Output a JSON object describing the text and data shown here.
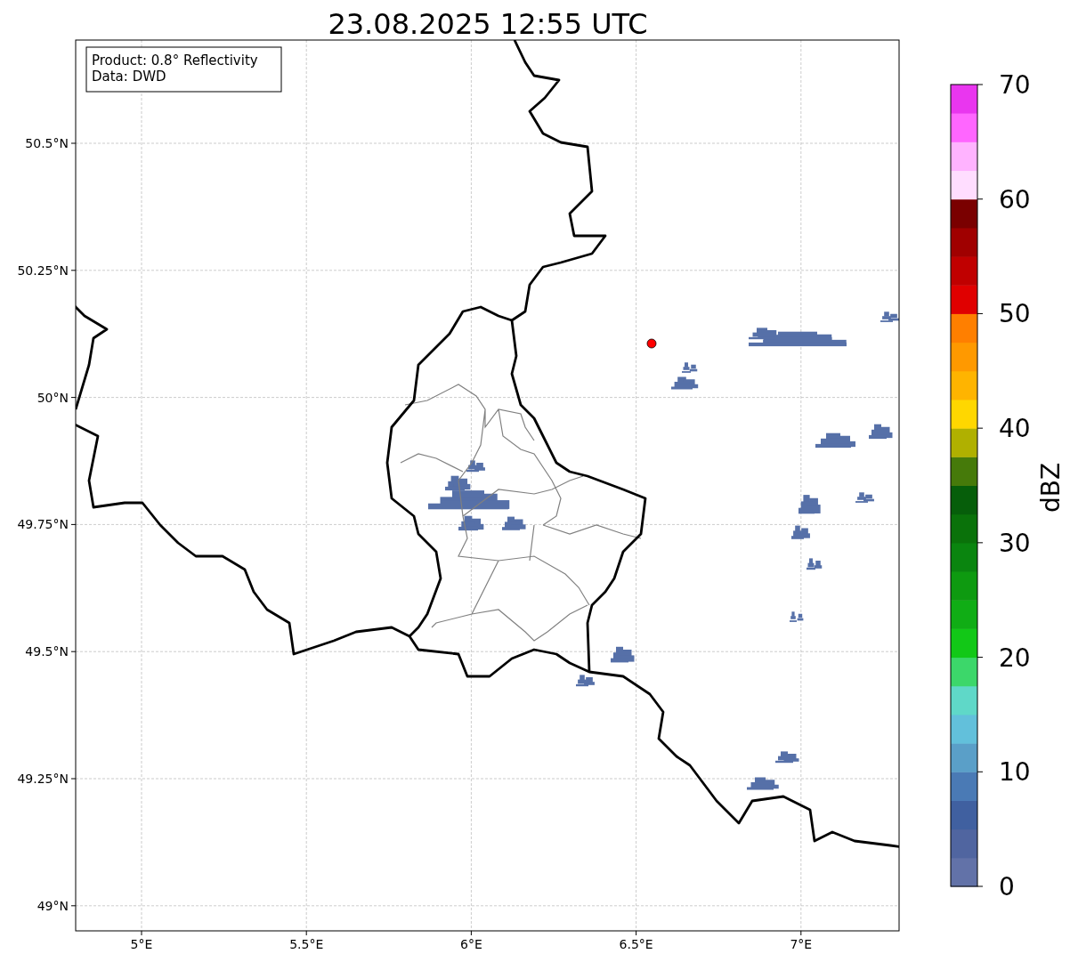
{
  "title": "23.08.2025 12:55 UTC",
  "map": {
    "info_box": [
      "Product: 0.8° Reflectivity",
      "Data: DWD"
    ],
    "yticks": [
      "50.5°N",
      "50.25°N",
      "50°N",
      "49.75°N",
      "49.5°N",
      "49.25°N",
      "49°N"
    ],
    "xticks": [
      "5°E",
      "5.5°E",
      "6°E",
      "6.5°E",
      "7°E"
    ]
  },
  "colorbar": {
    "label": "dBZ",
    "ticks": [
      "70",
      "60",
      "50",
      "40",
      "30",
      "20",
      "10",
      "0"
    ],
    "bins": [
      {
        "color": "#6272a8"
      },
      {
        "color": "#5065a0"
      },
      {
        "color": "#4060a0"
      },
      {
        "color": "#4a7ab5"
      },
      {
        "color": "#5a9fc8"
      },
      {
        "color": "#62c0db"
      },
      {
        "color": "#5fd8c8"
      },
      {
        "color": "#3cd76a"
      },
      {
        "color": "#12c817"
      },
      {
        "color": "#10ad15"
      },
      {
        "color": "#0e9a10"
      },
      {
        "color": "#0a850f"
      },
      {
        "color": "#0a720a"
      },
      {
        "color": "#065e0a"
      },
      {
        "color": "#467a0a"
      },
      {
        "color": "#b0b000"
      },
      {
        "color": "#ffd700"
      },
      {
        "color": "#ffb400"
      },
      {
        "color": "#ff9900"
      },
      {
        "color": "#ff7f00"
      },
      {
        "color": "#e00000"
      },
      {
        "color": "#c00000"
      },
      {
        "color": "#a00000"
      },
      {
        "color": "#7a0000"
      },
      {
        "color": "#ffddff"
      },
      {
        "color": "#ffb3ff"
      },
      {
        "color": "#ff66ff"
      },
      {
        "color": "#e936ef"
      }
    ]
  }
}
